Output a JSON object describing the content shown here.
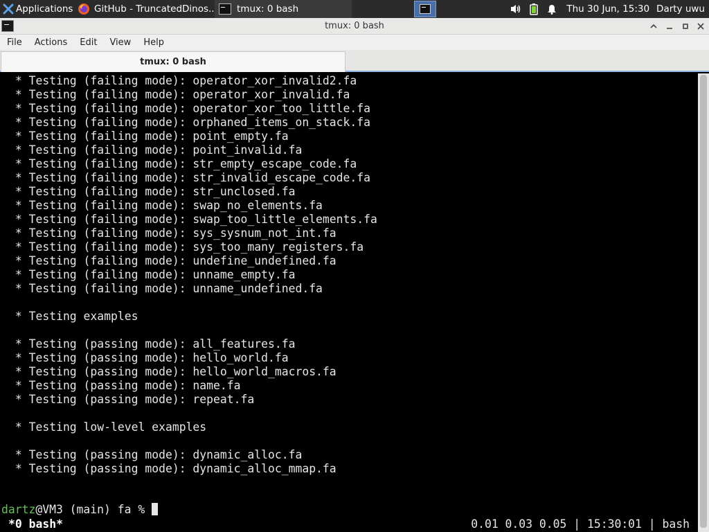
{
  "panel": {
    "applications_label": "Applications",
    "firefox_task_label": "GitHub - TruncatedDinos...",
    "terminal_task_label": "tmux: 0 bash",
    "clock": "Thu 30 Jun, 15:30",
    "user": "Darty uwu"
  },
  "window": {
    "title": "tmux: 0 bash"
  },
  "menubar": {
    "items": [
      "File",
      "Actions",
      "Edit",
      "View",
      "Help"
    ]
  },
  "tabs": [
    {
      "label": "tmux: 0 bash"
    }
  ],
  "terminal": {
    "lines": [
      " * Testing (failing mode): operator_xor_invalid2.fa",
      " * Testing (failing mode): operator_xor_invalid.fa",
      " * Testing (failing mode): operator_xor_too_little.fa",
      " * Testing (failing mode): orphaned_items_on_stack.fa",
      " * Testing (failing mode): point_empty.fa",
      " * Testing (failing mode): point_invalid.fa",
      " * Testing (failing mode): str_empty_escape_code.fa",
      " * Testing (failing mode): str_invalid_escape_code.fa",
      " * Testing (failing mode): str_unclosed.fa",
      " * Testing (failing mode): swap_no_elements.fa",
      " * Testing (failing mode): swap_too_little_elements.fa",
      " * Testing (failing mode): sys_sysnum_not_int.fa",
      " * Testing (failing mode): sys_too_many_registers.fa",
      " * Testing (failing mode): undefine_undefined.fa",
      " * Testing (failing mode): unname_empty.fa",
      " * Testing (failing mode): unname_undefined.fa",
      "",
      " * Testing examples",
      "",
      " * Testing (passing mode): all_features.fa",
      " * Testing (passing mode): hello_world.fa",
      " * Testing (passing mode): hello_world_macros.fa",
      " * Testing (passing mode): name.fa",
      " * Testing (passing mode): repeat.fa",
      "",
      " * Testing low-level examples",
      "",
      " * Testing (passing mode): dynamic_alloc.fa",
      " * Testing (passing mode): dynamic_alloc_mmap.fa"
    ],
    "prompt_user": "dartz",
    "prompt_rest": "@VM3 (main) fa % ",
    "status_left": "*0 bash*",
    "status_right": "0.01 0.03 0.05 | 15:30:01 | bash"
  }
}
